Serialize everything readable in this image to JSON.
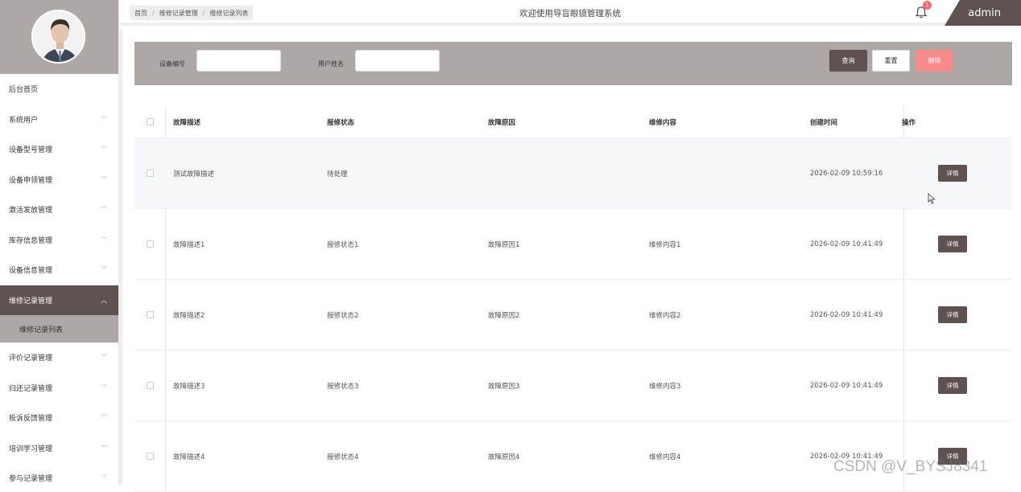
{
  "sidebar": {
    "items": [
      {
        "label": "后台首页",
        "has_children": false
      },
      {
        "label": "系统用户",
        "has_children": true
      },
      {
        "label": "设备型号管理",
        "has_children": true
      },
      {
        "label": "设备申领管理",
        "has_children": true
      },
      {
        "label": "激活发放管理",
        "has_children": true
      },
      {
        "label": "库存信息管理",
        "has_children": true
      },
      {
        "label": "设备信息管理",
        "has_children": true
      },
      {
        "label": "维修记录管理",
        "has_children": true,
        "active": true
      },
      {
        "label": "评价记录管理",
        "has_children": true
      },
      {
        "label": "归还记录管理",
        "has_children": true
      },
      {
        "label": "投诉反馈管理",
        "has_children": true
      },
      {
        "label": "培训学习管理",
        "has_children": true
      },
      {
        "label": "参与记录管理",
        "has_children": true
      }
    ],
    "active_sub_item": "维修记录列表"
  },
  "header": {
    "breadcrumb": [
      "首页",
      "维修记录管理",
      "维修记录列表"
    ],
    "title": "欢迎使用导盲眼镜管理系统",
    "notification_count": "1",
    "username": "admin"
  },
  "search": {
    "device_no_label": "设备编号",
    "device_no_value": "",
    "user_name_label": "用户姓名",
    "user_name_value": "",
    "query_label": "查询",
    "reset_label": "重置",
    "delete_label": "删除"
  },
  "table": {
    "columns": [
      "故障描述",
      "报修状态",
      "故障原因",
      "维修内容",
      "创建时间",
      "操作"
    ],
    "rows": [
      {
        "desc": "测试故障描述",
        "status": "待处理",
        "reason": "",
        "content": "",
        "created": "2026-02-09 10:59:16",
        "action": "详情"
      },
      {
        "desc": "故障描述1",
        "status": "报修状态1",
        "reason": "故障原因1",
        "content": "维修内容1",
        "created": "2026-02-09 10:41:49",
        "action": "详情"
      },
      {
        "desc": "故障描述2",
        "status": "报修状态2",
        "reason": "故障原因2",
        "content": "维修内容2",
        "created": "2026-02-09 10:41:49",
        "action": "详情"
      },
      {
        "desc": "故障描述3",
        "status": "报修状态3",
        "reason": "故障原因3",
        "content": "维修内容3",
        "created": "2026-02-09 10:41:49",
        "action": "详情"
      },
      {
        "desc": "故障描述4",
        "status": "报修状态4",
        "reason": "故障原因4",
        "content": "维修内容4",
        "created": "2026-02-09 10:41:49",
        "action": "详情"
      }
    ]
  },
  "watermark": "CSDN @V_BYSJ8341",
  "colors": {
    "primary": "#5e5150",
    "secondary": "#ada7a5",
    "danger": "#f78989",
    "badge": "#f56c6c"
  }
}
